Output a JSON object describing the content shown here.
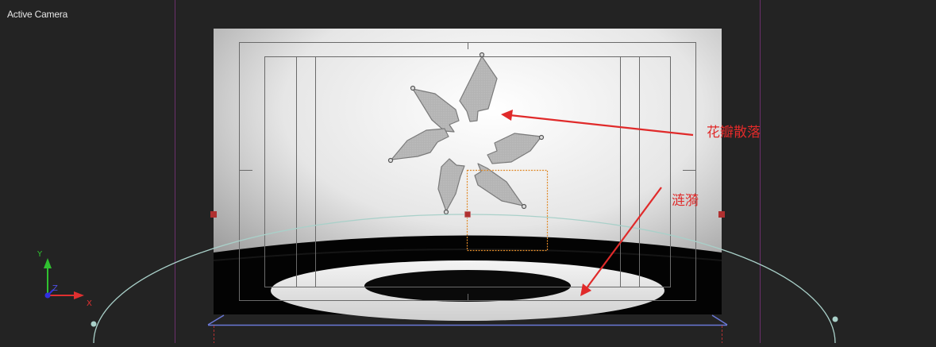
{
  "viewport": {
    "label": "Active Camera"
  },
  "annotations": [
    {
      "text": "花瓣散落"
    },
    {
      "text": "涟漪"
    }
  ],
  "axis_gizmo": {
    "x": "X",
    "y": "Y",
    "z": "Z"
  },
  "colors": {
    "background": "#232323",
    "annotation_red": "#e02a2a",
    "guide_purple": "#6b2f6b",
    "ripple_ring": "#a9d0c9",
    "ground_plane": "#6a78d6",
    "selection_orange": "#e08a2a",
    "handle_red": "#b03030",
    "petal_gray": "#b2b2b2",
    "axis_x": "#e03030",
    "axis_y": "#30c030",
    "axis_z": "#3030e0"
  }
}
